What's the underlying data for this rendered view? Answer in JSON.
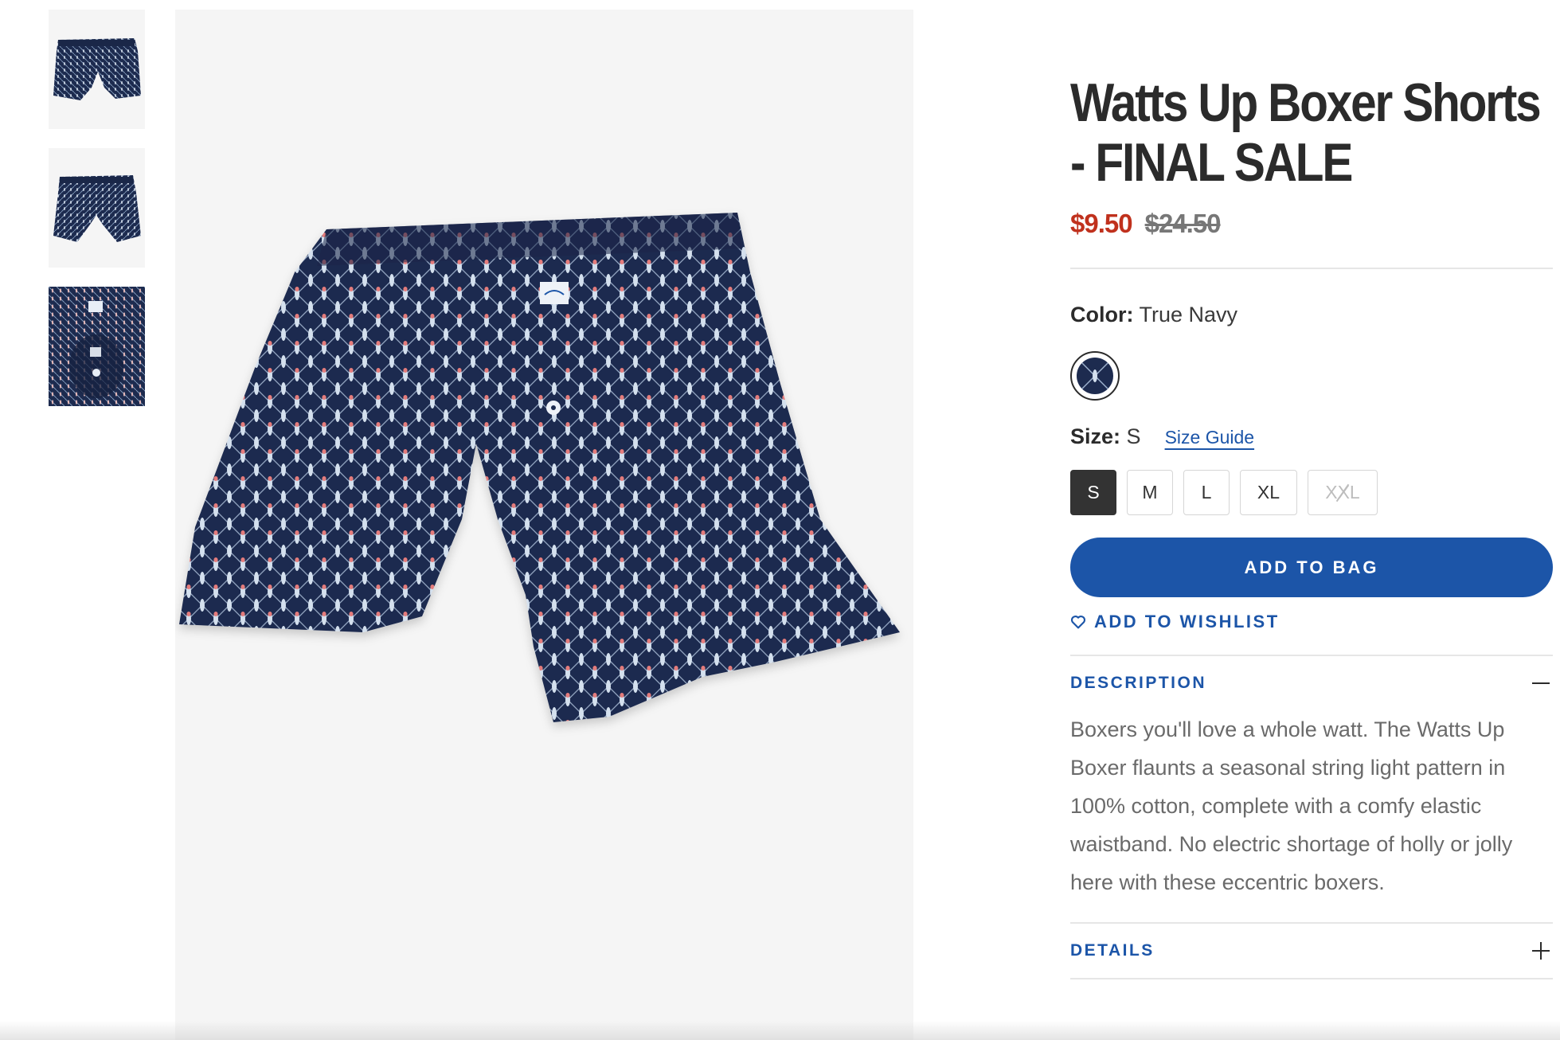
{
  "gallery": {
    "thumbnails": [
      {
        "view": "front"
      },
      {
        "view": "back"
      },
      {
        "view": "detail"
      }
    ]
  },
  "product": {
    "title": "Watts Up Boxer Shorts - FINAL SALE",
    "sale_price": "$9.50",
    "original_price": "$24.50"
  },
  "color": {
    "label": "Color:",
    "value": "True Navy",
    "swatch_hex": "#1d2b4f"
  },
  "size": {
    "label": "Size:",
    "value": "S",
    "guide_label": "Size Guide",
    "options": [
      {
        "label": "S",
        "selected": true,
        "available": true
      },
      {
        "label": "M",
        "selected": false,
        "available": true
      },
      {
        "label": "L",
        "selected": false,
        "available": true
      },
      {
        "label": "XL",
        "selected": false,
        "available": true
      },
      {
        "label": "XXL",
        "selected": false,
        "available": false
      }
    ]
  },
  "actions": {
    "add_to_bag": "ADD TO BAG",
    "add_to_wishlist": "ADD TO WISHLIST"
  },
  "accordion": {
    "description": {
      "title": "DESCRIPTION",
      "expanded": true,
      "text": "Boxers you'll love a whole watt. The Watts Up Boxer flaunts a seasonal string light pattern in 100% cotton, complete with a comfy elastic waistband. No electric shortage of holly or jolly here with these eccentric boxers."
    },
    "details": {
      "title": "DETAILS",
      "expanded": false
    }
  },
  "colors": {
    "brand_blue": "#1c55a8",
    "sale_red": "#c0311d",
    "fabric_navy": "#1d2b4f",
    "text_dark": "#2b2b2b",
    "image_bg": "#f5f5f5"
  }
}
